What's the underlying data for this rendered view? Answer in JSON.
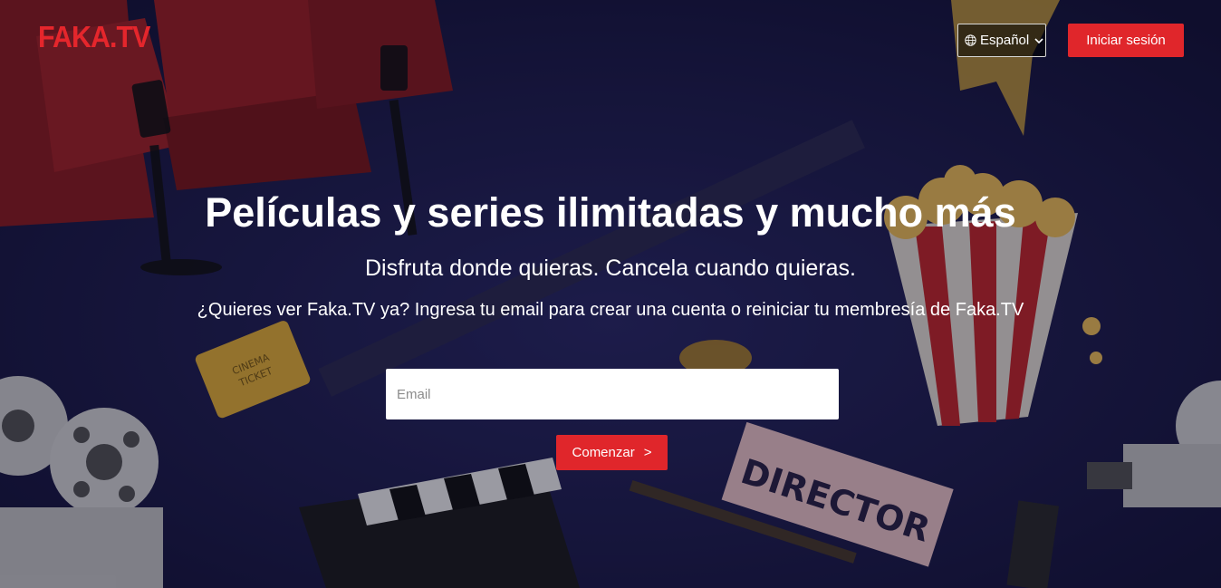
{
  "brand": {
    "logo_text": "FAKA.TV",
    "accent_color": "#e0262b"
  },
  "header": {
    "language_select": {
      "value": "Español",
      "icon": "globe-icon"
    },
    "signin_label": "Iniciar sesión"
  },
  "hero": {
    "title": "Películas y series ilimitadas y mucho más",
    "subtitle": "Disfruta donde quieras. Cancela cuando quieras.",
    "cta_text": "¿Quieres ver Faka.TV ya? Ingresa tu email para crear una cuenta o reiniciar tu membresía de Faka.TV",
    "email_placeholder": "Email",
    "start_label": "Comenzar",
    "start_arrow": ">"
  },
  "background": {
    "director_chair_text": "DIRECTOR",
    "ticket_text": "CINEMA TICKET"
  }
}
